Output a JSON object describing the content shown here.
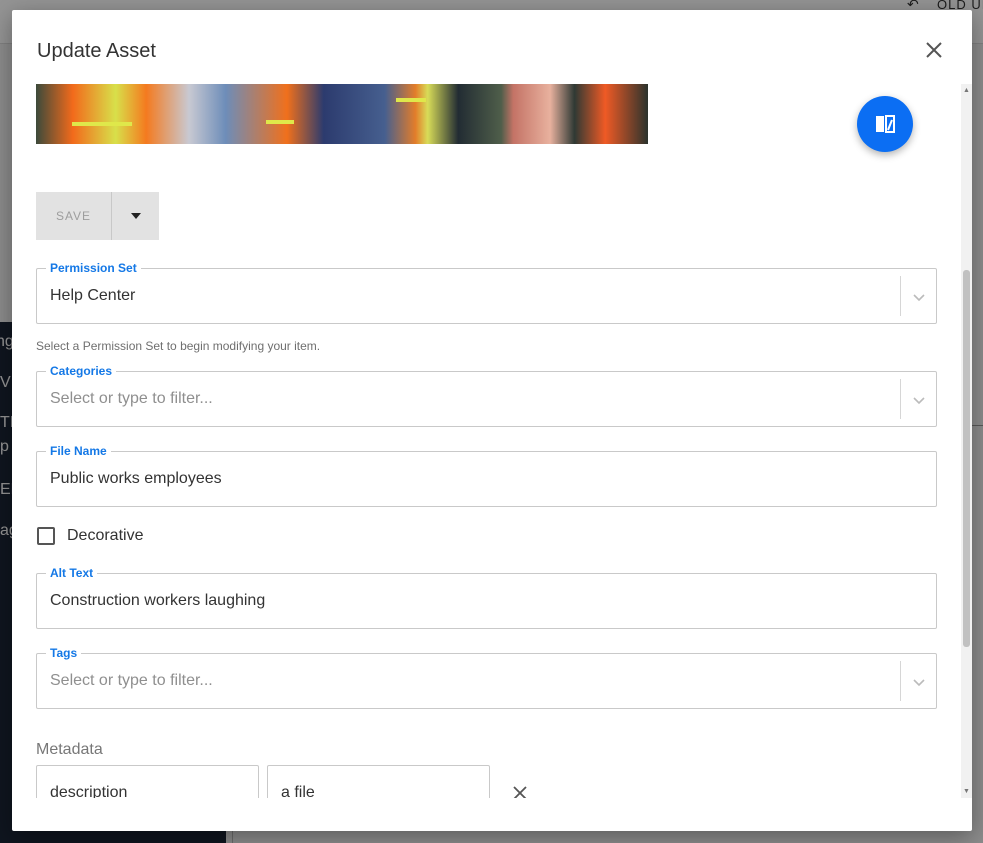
{
  "background": {
    "top_right_label": "OLD UI",
    "sidebar_fragments": [
      "ng",
      "V",
      "TI",
      "p",
      "EN",
      "ag"
    ]
  },
  "modal": {
    "title": "Update Asset",
    "save_label": "SAVE",
    "permission_set": {
      "label": "Permission Set",
      "value": "Help Center",
      "helper": "Select a Permission Set to begin modifying your item."
    },
    "categories": {
      "label": "Categories",
      "placeholder": "Select or type to filter..."
    },
    "file_name": {
      "label": "File Name",
      "value": "Public works employees"
    },
    "decorative": {
      "label": "Decorative",
      "checked": false
    },
    "alt_text": {
      "label": "Alt Text",
      "value": "Construction workers laughing"
    },
    "tags": {
      "label": "Tags",
      "placeholder": "Select or type to filter..."
    },
    "metadata": {
      "label": "Metadata",
      "rows": [
        {
          "key": "description",
          "value": "a file"
        }
      ]
    }
  },
  "icons": {
    "close": "close-icon",
    "compare": "compare-icon",
    "save_menu": "caret-down-icon",
    "dropdown": "chevron-down-icon",
    "remove": "close-icon"
  },
  "colors": {
    "accent": "#1478e6",
    "fab": "#0b6ef3",
    "sidebar": "#1b2536",
    "disabled_button": "#e2e2e2"
  }
}
